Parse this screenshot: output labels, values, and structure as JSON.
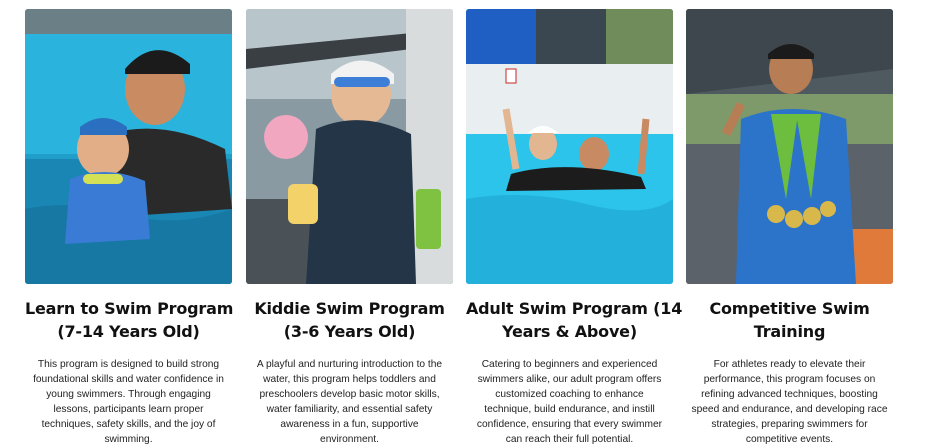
{
  "programs": [
    {
      "title_lines": [
        "Learn to Swim Program",
        "(7-14 Years Old)"
      ],
      "desc_lines": [
        "This program is designed to build strong",
        "foundational skills and water confidence in",
        "young swimmers. Through engaging",
        "lessons, participants learn proper",
        "techniques, safety skills, and the joy of",
        "swimming."
      ],
      "photo_alt": "Instructor with child in pool"
    },
    {
      "title_lines": [
        "Kiddie Swim Program",
        "(3-6 Years Old)"
      ],
      "desc_lines": [
        "A playful and nurturing introduction to the",
        "water, this program helps toddlers and",
        "preschoolers develop basic motor skills,",
        "water familiarity, and essential safety",
        "awareness in a fun, supportive",
        "environment."
      ],
      "photo_alt": "Toddler with toy at pool edge"
    },
    {
      "title_lines": [
        "Adult Swim Program (14",
        "Years & Above)"
      ],
      "desc_lines": [
        "Catering to beginners and experienced",
        "swimmers alike, our adult program offers",
        "customized coaching to enhance",
        "technique, build endurance, and instill",
        "confidence, ensuring that every swimmer",
        "can reach their full potential."
      ],
      "photo_alt": "Two swimmers in outdoor pool"
    },
    {
      "title_lines": [
        "Competitive Swim",
        "Training"
      ],
      "desc_lines": [
        "For athletes ready to elevate their",
        "performance, this program focuses on",
        "refining advanced techniques, boosting",
        "speed and endurance, and developing race",
        "strategies, preparing swimmers for",
        "competitive events."
      ],
      "photo_alt": "Young swimmer with medals"
    }
  ]
}
